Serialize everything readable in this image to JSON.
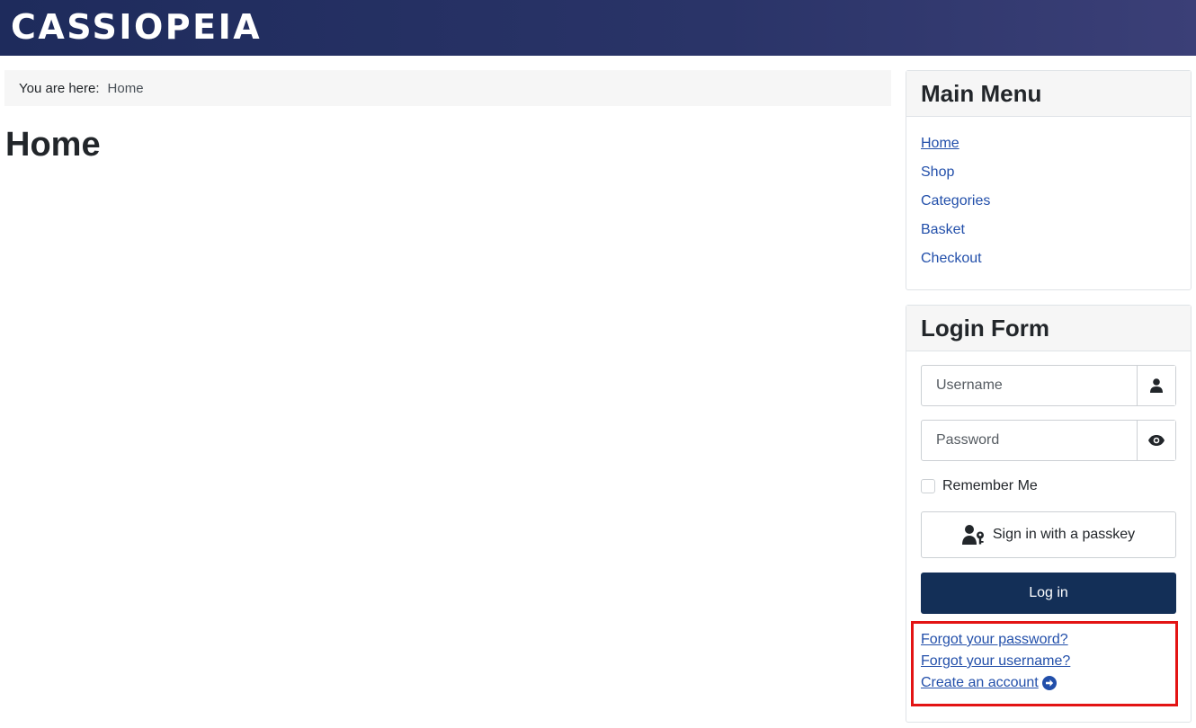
{
  "header": {
    "brand": "CASSIOPEIA"
  },
  "breadcrumb": {
    "prefix": "You are here:",
    "current": "Home"
  },
  "page": {
    "title": "Home"
  },
  "main_menu": {
    "title": "Main Menu",
    "items": [
      {
        "label": "Home",
        "active": true
      },
      {
        "label": "Shop"
      },
      {
        "label": "Categories"
      },
      {
        "label": "Basket"
      },
      {
        "label": "Checkout"
      }
    ]
  },
  "login_form": {
    "title": "Login Form",
    "username_placeholder": "Username",
    "password_placeholder": "Password",
    "remember_label": "Remember Me",
    "passkey_label": "Sign in with a passkey",
    "login_label": "Log in",
    "links": {
      "forgot_password": "Forgot your password?",
      "forgot_username": "Forgot your username?",
      "create_account": "Create an account"
    }
  },
  "icons": {
    "username": "user-icon",
    "password": "eye-icon",
    "passkey": "user-key-icon",
    "create_account": "arrow-circle-right-icon"
  },
  "colors": {
    "header_bg": "#1e2b5c",
    "link": "#224faa",
    "login_button": "#132f57",
    "highlight": "#e31414"
  }
}
